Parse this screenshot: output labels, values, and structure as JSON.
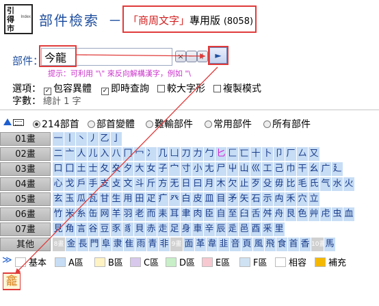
{
  "logo": {
    "glyphs": [
      "引",
      "得",
      "市"
    ],
    "subtext": "Index"
  },
  "header": {
    "title": "部件檢索",
    "dash": "－",
    "edition_quoted": "「商周文字」",
    "edition_suffix": "專用版",
    "edition_count": "(8058)"
  },
  "query": {
    "label": "部件：",
    "value": "今龍",
    "buttons": {
      "clear": "×",
      "minus": "－",
      "plus": "＋",
      "go": "►"
    },
    "hint": "提示：可利用 \"\\\" 來反向解構漢字，例如 \"\\"
  },
  "options": {
    "label": "選項：",
    "items": [
      {
        "label": "包容異體",
        "checked": true
      },
      {
        "label": "即時查詢",
        "checked": true
      },
      {
        "label": "較大字形",
        "checked": false
      },
      {
        "label": "複製模式",
        "checked": false
      }
    ],
    "count_label": "字數：",
    "count_text": "總計 1 字"
  },
  "tabs": {
    "items": [
      {
        "label": "214部首",
        "selected": true
      },
      {
        "label": "部首變體",
        "selected": false
      },
      {
        "label": "難輸部件",
        "selected": false
      },
      {
        "label": "常用部件",
        "selected": false
      },
      {
        "label": "所有部件",
        "selected": false
      }
    ]
  },
  "grid": {
    "rows": [
      {
        "label": "01畫",
        "cells": [
          "一",
          "丨",
          "丶",
          "丿",
          "乙",
          "亅"
        ]
      },
      {
        "label": "02畫",
        "cells": [
          "二",
          "亠",
          "人",
          "儿",
          "入",
          "八",
          "冂",
          "冖",
          "冫",
          "几",
          "凵",
          "刀",
          "力",
          "勹",
          "匕",
          "匚",
          "匸",
          "十",
          "卜",
          "卩",
          "厂",
          "厶",
          "又"
        ]
      },
      {
        "label": "03畫",
        "cells": [
          "口",
          "囗",
          "土",
          "士",
          "夂",
          "夊",
          "夕",
          "大",
          "女",
          "子",
          "宀",
          "寸",
          "小",
          "尢",
          "尸",
          "屮",
          "山",
          "巛",
          "工",
          "己",
          "巾",
          "干",
          "幺",
          "广",
          "廴"
        ]
      },
      {
        "label": "04畫",
        "cells": [
          "心",
          "戈",
          "戶",
          "手",
          "支",
          "攴",
          "文",
          "斗",
          "斤",
          "方",
          "无",
          "日",
          "曰",
          "月",
          "木",
          "欠",
          "止",
          "歹",
          "殳",
          "毋",
          "比",
          "毛",
          "氏",
          "气",
          "水",
          "火"
        ]
      },
      {
        "label": "05畫",
        "cells": [
          "玄",
          "玉",
          "瓜",
          "瓦",
          "甘",
          "生",
          "用",
          "田",
          "疋",
          "疒",
          "癶",
          "白",
          "皮",
          "皿",
          "目",
          "矛",
          "矢",
          "石",
          "示",
          "禸",
          "禾",
          "穴",
          "立"
        ]
      },
      {
        "label": "06畫",
        "cells": [
          "竹",
          "米",
          "糸",
          "缶",
          "网",
          "羊",
          "羽",
          "老",
          "而",
          "耒",
          "耳",
          "聿",
          "肉",
          "臣",
          "自",
          "至",
          "臼",
          "舌",
          "舛",
          "舟",
          "艮",
          "色",
          "艸",
          "虍",
          "虫",
          "血"
        ]
      },
      {
        "label": "07畫",
        "cells": [
          "見",
          "角",
          "言",
          "谷",
          "豆",
          "豕",
          "豸",
          "貝",
          "赤",
          "走",
          "足",
          "身",
          "車",
          "辛",
          "辰",
          "辵",
          "邑",
          "酉",
          "釆",
          "里"
        ]
      },
      {
        "label": "其他",
        "cells": [
          "8畫",
          "金",
          "長",
          "門",
          "阜",
          "隶",
          "隹",
          "雨",
          "青",
          "非",
          "9畫",
          "面",
          "革",
          "韋",
          "韭",
          "音",
          "頁",
          "風",
          "飛",
          "食",
          "首",
          "香",
          "10畫",
          "馬"
        ]
      }
    ],
    "pink_cells": [
      "匕"
    ]
  },
  "legend": {
    "chevron": "≫",
    "items": [
      {
        "label": "基本",
        "color": "#ffffff"
      },
      {
        "label": "A區",
        "color": "#c7ddf5"
      },
      {
        "label": "B區",
        "color": "#fff3c4"
      },
      {
        "label": "C區",
        "color": "#d7c8ec"
      },
      {
        "label": "D區",
        "color": "#c8efc8"
      },
      {
        "label": "E區",
        "color": "#f7c8d0"
      },
      {
        "label": "F區",
        "color": "#cfe2f3"
      },
      {
        "label": "相容",
        "color": "#ffffff"
      },
      {
        "label": "補充",
        "color": "#f5b800"
      }
    ]
  },
  "result": {
    "chars": [
      "龕"
    ]
  },
  "colors": {
    "accent_blue": "#1f4f9f",
    "highlight_red": "#e03a3a",
    "hint_magenta": "#cc33cc"
  }
}
